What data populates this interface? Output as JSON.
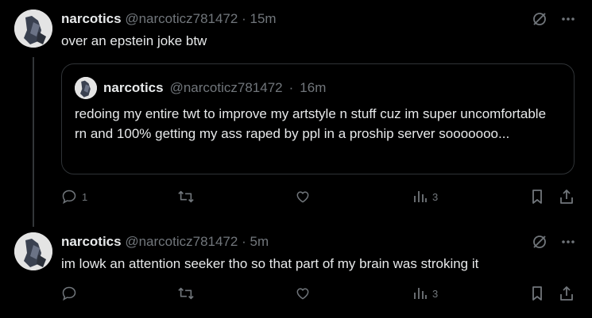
{
  "posts": [
    {
      "display_name": "narcotics",
      "handle": "@narcoticz781472",
      "separator": "·",
      "time": "15m",
      "text": "over an epstein joke btw",
      "quote": {
        "display_name": "narcotics",
        "handle": "@narcoticz781472",
        "separator": "·",
        "time": "16m",
        "text": "redoing my entire twt to improve my artstyle n stuff cuz im super uncomfortable rn and 100% getting my ass raped by ppl in a proship server sooooooo..."
      },
      "replies": "1",
      "reposts": "",
      "likes": "",
      "views": "3"
    },
    {
      "display_name": "narcotics",
      "handle": "@narcoticz781472",
      "separator": "·",
      "time": "5m",
      "text": "im lowk an attention seeker tho so that part of my brain was stroking it",
      "replies": "",
      "reposts": "",
      "likes": "",
      "views": "3"
    }
  ],
  "icons": {
    "grok": "grok-icon",
    "more": "more-icon",
    "reply": "reply-icon",
    "repost": "repost-icon",
    "like": "like-icon",
    "views": "views-icon",
    "bookmark": "bookmark-icon",
    "share": "share-icon"
  }
}
